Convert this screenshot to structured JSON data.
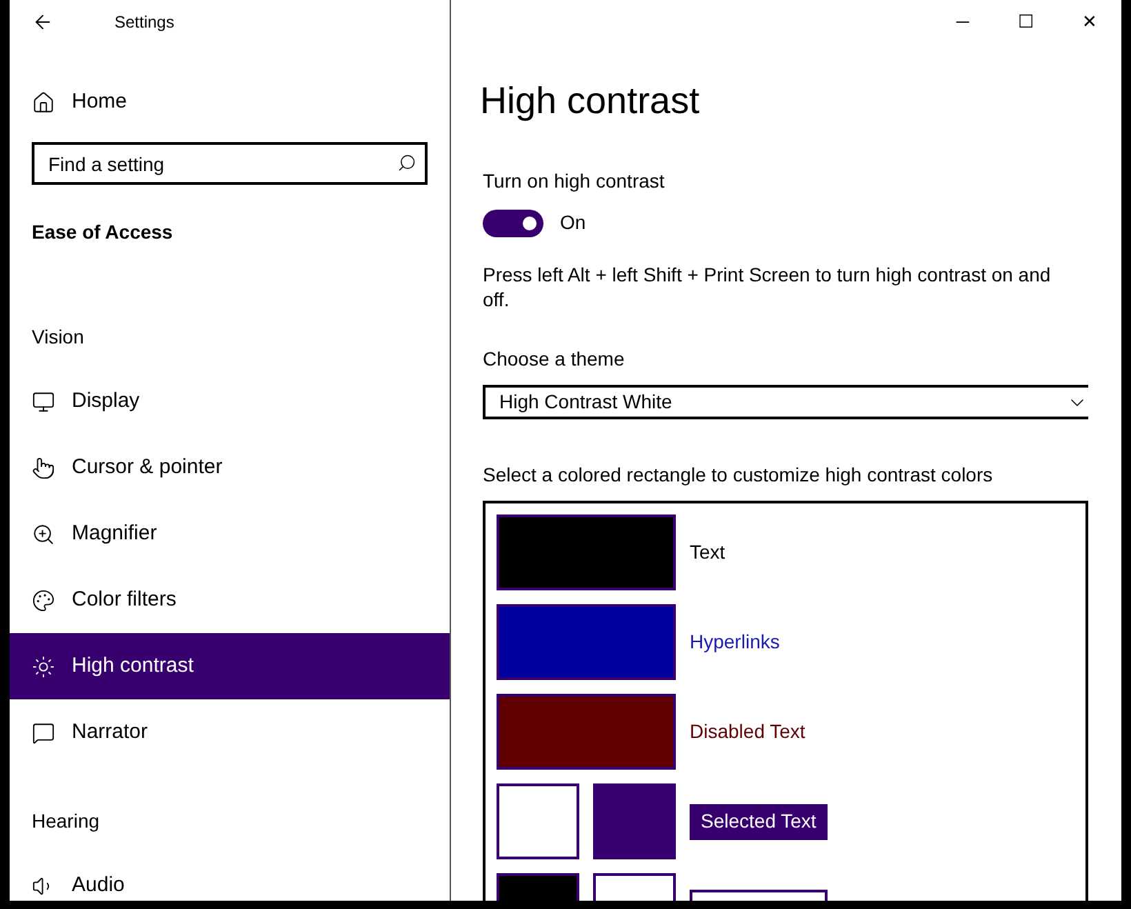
{
  "window": {
    "title": "Settings",
    "controls": [
      "─",
      "☐",
      "✕"
    ]
  },
  "sidebar": {
    "home": "Home",
    "search": {
      "placeholder": "Find a setting"
    },
    "category": "Ease of Access",
    "sections": [
      {
        "heading": "Vision",
        "items": [
          {
            "label": "Display",
            "selected": false
          },
          {
            "label": "Cursor & pointer",
            "selected": false
          },
          {
            "label": "Magnifier",
            "selected": false
          },
          {
            "label": "Color filters",
            "selected": false
          },
          {
            "label": "High contrast",
            "selected": true
          },
          {
            "label": "Narrator",
            "selected": false
          }
        ]
      },
      {
        "heading": "Hearing",
        "items": [
          {
            "label": "Audio",
            "selected": false
          }
        ]
      }
    ]
  },
  "page": {
    "title": "High contrast",
    "toggle": {
      "label": "Turn on high contrast",
      "on": true,
      "state_text": "On"
    },
    "hint": "Press left Alt + left Shift + Print Screen to turn high contrast on and off.",
    "theme": {
      "label": "Choose a theme",
      "value": "High Contrast White"
    },
    "colors_label": "Select a colored rectangle to customize high contrast colors",
    "color_rows": [
      {
        "kind": "single",
        "swatches": [
          {
            "color": "#000000"
          }
        ],
        "label": {
          "text": "Text",
          "color": "#000000"
        }
      },
      {
        "kind": "single",
        "swatches": [
          {
            "color": "#00009f"
          }
        ],
        "label": {
          "text": "Hyperlinks",
          "color": "#1a1ab0"
        }
      },
      {
        "kind": "single",
        "swatches": [
          {
            "color": "#600000"
          }
        ],
        "label": {
          "text": "Disabled Text",
          "color": "#600000"
        }
      },
      {
        "kind": "pair",
        "swatches": [
          {
            "color": "#ffffff"
          },
          {
            "color": "#37006e"
          }
        ],
        "label": {
          "text": "Selected Text",
          "color": "#ffffff",
          "highlight": {
            "color": "#37006e"
          }
        }
      },
      {
        "kind": "pair",
        "swatches": [
          {
            "color": "#000000"
          },
          {
            "color": "#ffffff"
          }
        ],
        "preview": {
          "color": "#ffffff"
        }
      }
    ]
  }
}
